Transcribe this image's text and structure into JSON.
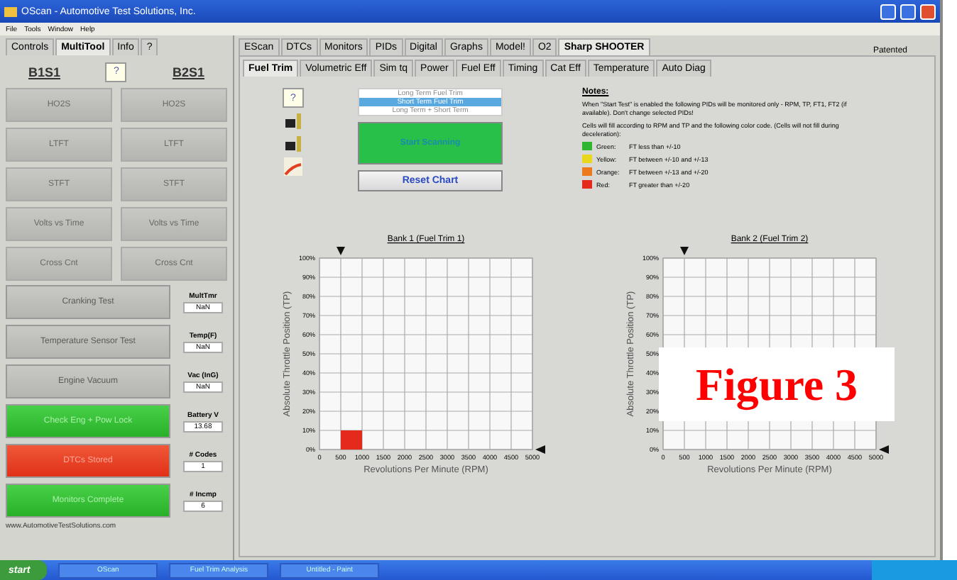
{
  "window": {
    "title": "OScan - Automotive Test Solutions, Inc."
  },
  "menu": [
    "File",
    "Tools",
    "Window",
    "Help"
  ],
  "left_tabs": [
    {
      "label": "Controls",
      "selected": false
    },
    {
      "label": "MultiTool",
      "selected": true
    },
    {
      "label": "Info",
      "selected": false
    },
    {
      "label": "?",
      "selected": false
    }
  ],
  "sensors": {
    "left": "B1S1",
    "help": "?",
    "right": "B2S1"
  },
  "grey_buttons": [
    "HO2S",
    "HO2S",
    "LTFT",
    "LTFT",
    "STFT",
    "STFT",
    "Volts vs Time",
    "Volts vs Time",
    "Cross Cnt",
    "Cross Cnt"
  ],
  "wide_buttons": [
    {
      "label": "Cranking Test",
      "kind": "grey"
    },
    {
      "label": "Temperature Sensor Test",
      "kind": "grey"
    },
    {
      "label": "Engine Vacuum",
      "kind": "grey"
    },
    {
      "label": "Check Eng + Pow Lock",
      "kind": "green"
    },
    {
      "label": "DTCs Stored",
      "kind": "red"
    },
    {
      "label": "Monitors Complete",
      "kind": "green"
    }
  ],
  "readouts": [
    {
      "label": "MultTmr",
      "value": "NaN"
    },
    {
      "label": "Temp(F)",
      "value": "NaN"
    },
    {
      "label": "Vac (InG)",
      "value": "NaN"
    },
    {
      "label": "Battery V",
      "value": "13.68"
    },
    {
      "label": "# Codes",
      "value": "1"
    },
    {
      "label": "# Incmp",
      "value": "6"
    }
  ],
  "website": "www.AutomotiveTestSolutions.com",
  "main_tabs": [
    {
      "label": "EScan",
      "selected": false
    },
    {
      "label": "DTCs",
      "selected": false
    },
    {
      "label": "Monitors",
      "selected": false
    },
    {
      "label": "PIDs",
      "selected": false
    },
    {
      "label": "Digital",
      "selected": false
    },
    {
      "label": "Graphs",
      "selected": false
    },
    {
      "label": "Model!",
      "selected": false
    },
    {
      "label": "O2",
      "selected": false
    },
    {
      "label": "Sharp SHOOTER",
      "selected": true
    }
  ],
  "patented": "Patented",
  "sub_tabs": [
    {
      "label": "Fuel Trim",
      "selected": true
    },
    {
      "label": "Volumetric Eff",
      "selected": false
    },
    {
      "label": "Sim tq",
      "selected": false
    },
    {
      "label": "Power",
      "selected": false
    },
    {
      "label": "Fuel Eff",
      "selected": false
    },
    {
      "label": "Timing",
      "selected": false
    },
    {
      "label": "Cat Eff",
      "selected": false
    },
    {
      "label": "Temperature",
      "selected": false
    },
    {
      "label": "Auto Diag",
      "selected": false
    }
  ],
  "help_button": "?",
  "trim_list": [
    {
      "label": "Long Term Fuel Trim",
      "selected": false
    },
    {
      "label": "Short Term Fuel Trim",
      "selected": true
    },
    {
      "label": "Long Term + Short Term",
      "selected": false
    }
  ],
  "start_button": "Start Scanning",
  "reset_button": "Reset Chart",
  "notes": {
    "title": "Notes:",
    "paragraph_1": "When \"Start Test\" is enabled the following PIDs will be monitored only - RPM, TP, FT1, FT2 (if available). Don't change selected PIDs!",
    "paragraph_2": "Cells will fill according to RPM and TP and the following color code. (Cells will not fill during deceleration):",
    "legend": [
      {
        "name": "Green:",
        "text": "FT less than +/-10",
        "color": "#2fb52f"
      },
      {
        "name": "Yellow:",
        "text": "FT between +/-10 and +/-13",
        "color": "#e8d81c"
      },
      {
        "name": "Orange:",
        "text": "FT between +/-13 and +/-20",
        "color": "#ec7a1c"
      },
      {
        "name": "Red:",
        "text": "FT greater than +/-20",
        "color": "#e42a1c"
      }
    ]
  },
  "charts": [
    {
      "chart_data": {
        "type": "scatter",
        "title": "Bank 1 (Fuel Trim 1)",
        "xlabel": "Revolutions Per Minute (RPM)",
        "ylabel": "Absolute Throttle Position (TP)",
        "xlim": [
          0,
          5000
        ],
        "ylim": [
          0,
          100
        ],
        "xticks": [
          0,
          500,
          1000,
          1500,
          2000,
          2500,
          3000,
          3500,
          4000,
          4500,
          5000
        ],
        "yticks": [
          {
            "value": 0,
            "label": "0%"
          },
          {
            "value": 10,
            "label": "10%"
          },
          {
            "value": 20,
            "label": "20%"
          },
          {
            "value": 30,
            "label": "30%"
          },
          {
            "value": 40,
            "label": "40%"
          },
          {
            "value": 50,
            "label": "50%"
          },
          {
            "value": 60,
            "label": "60%"
          },
          {
            "value": 70,
            "label": "70%"
          },
          {
            "value": 80,
            "label": "80%"
          },
          {
            "value": 90,
            "label": "90%"
          },
          {
            "value": 100,
            "label": "100%"
          }
        ],
        "grid": true,
        "x": [
          750
        ],
        "series": [
          {
            "color": "#e42a1c",
            "values": [
              5
            ]
          }
        ]
      }
    },
    {
      "chart_data": {
        "type": "scatter",
        "title": "Bank 2 (Fuel Trim 2)",
        "xlabel": "Revolutions Per Minute (RPM)",
        "ylabel": "Absolute Throttle Position (TP)",
        "xlim": [
          0,
          5000
        ],
        "ylim": [
          0,
          100
        ],
        "xticks": [
          0,
          500,
          1000,
          1500,
          2000,
          2500,
          3000,
          3500,
          4000,
          4500,
          5000
        ],
        "yticks": [
          {
            "value": 0,
            "label": "0%"
          },
          {
            "value": 10,
            "label": "10%"
          },
          {
            "value": 20,
            "label": "20%"
          },
          {
            "value": 30,
            "label": "30%"
          },
          {
            "value": 40,
            "label": "40%"
          },
          {
            "value": 50,
            "label": "50%"
          },
          {
            "value": 60,
            "label": "60%"
          },
          {
            "value": 70,
            "label": "70%"
          },
          {
            "value": 80,
            "label": "80%"
          },
          {
            "value": 90,
            "label": "90%"
          },
          {
            "value": 100,
            "label": "100%"
          }
        ],
        "grid": true
      }
    }
  ],
  "figure_label": "Figure 3",
  "taskbar": {
    "start": "start",
    "items": [
      "OScan",
      "Fuel Trim Analysis",
      "Untitled - Paint"
    ]
  }
}
